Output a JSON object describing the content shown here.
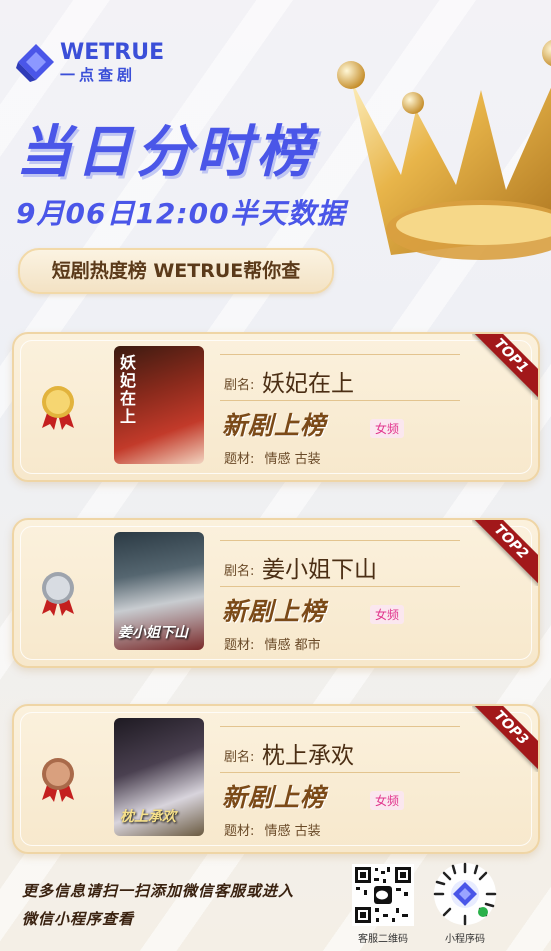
{
  "brand": {
    "name_en": "WETRUE",
    "name_cn": "一点查剧"
  },
  "title": "当日分时榜",
  "subtitle": "9月06日12:00半天数据",
  "tag": "短剧热度榜 WETRUE帮你查",
  "colors": {
    "accent": "#4a56e8",
    "gold": "#efd5a5",
    "ribbon": "#a2181a",
    "tag_pink": "#e1338c"
  },
  "cards": [
    {
      "rank_label": "TOP1",
      "medal": "gold",
      "name_label": "剧名:",
      "name": "妖妃在上",
      "badge": "新剧上榜",
      "gender": "女频",
      "genre_label": "题材:",
      "genre": "情感 古装",
      "poster_text": "妖妃在上"
    },
    {
      "rank_label": "TOP2",
      "medal": "silver",
      "name_label": "剧名:",
      "name": "姜小姐下山",
      "badge": "新剧上榜",
      "gender": "女频",
      "genre_label": "题材:",
      "genre": "情感 都市",
      "poster_text": "姜小姐下山"
    },
    {
      "rank_label": "TOP3",
      "medal": "bronze",
      "name_label": "剧名:",
      "name": "枕上承欢",
      "badge": "新剧上榜",
      "gender": "女频",
      "genre_label": "题材:",
      "genre": "情感 古装",
      "poster_text": "枕上承欢"
    }
  ],
  "footer": {
    "line1": "更多信息请扫一扫添加微信客服或进入",
    "line2": "微信小程序查看",
    "qr1_label": "客服二维码",
    "qr2_label": "小程序码"
  }
}
